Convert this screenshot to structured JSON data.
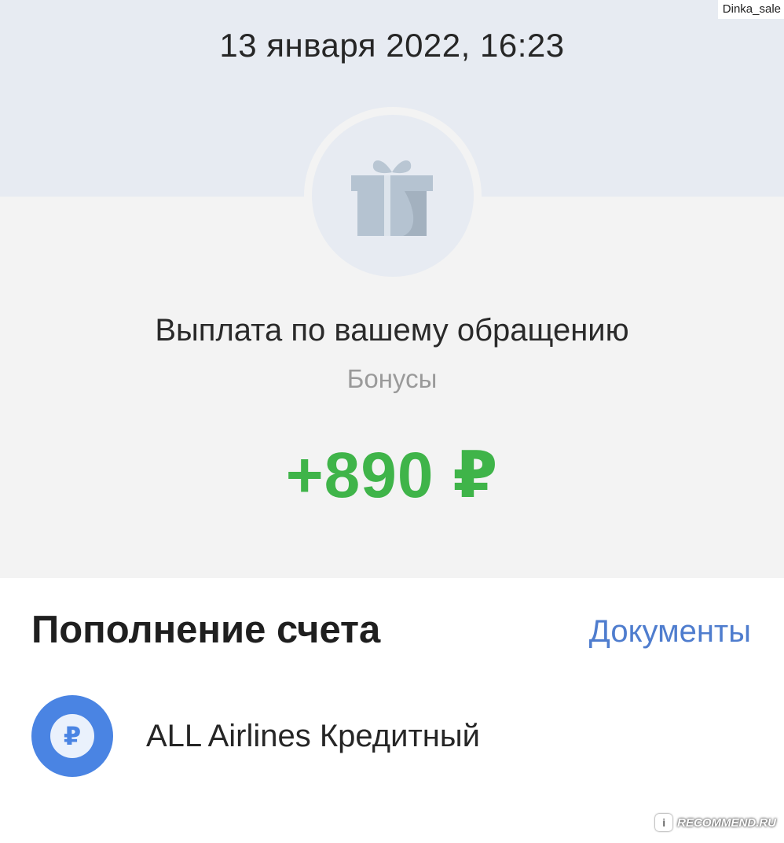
{
  "watermark_top": "Dinka_sale",
  "header": {
    "date": "13 января 2022, 16:23"
  },
  "operation": {
    "icon": "gift-icon",
    "title": "Выплата по вашему обращению",
    "category": "Бонусы",
    "amount": "+890 ₽",
    "amount_color": "#3fb449"
  },
  "details": {
    "section_title": "Пополнение счета",
    "documents_label": "Документы",
    "account": {
      "icon": "ruble-icon",
      "symbol": "₽",
      "name": "ALL Airlines Кредитный"
    }
  },
  "watermark_bottom": {
    "badge": "i",
    "text": "RECOMMEND.RU"
  },
  "colors": {
    "header_bg": "#e7ebf2",
    "body_bg": "#f3f3f3",
    "link": "#4f7dce",
    "account_icon": "#4a84e3"
  }
}
